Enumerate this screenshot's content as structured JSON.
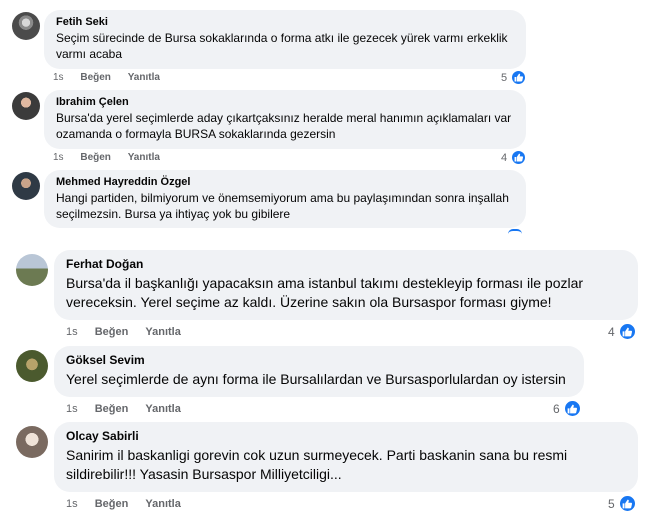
{
  "ui": {
    "like_label": "Beğen",
    "reply_label": "Yanıtla",
    "time_label": "1s",
    "colors": {
      "bubble_bg": "#f0f2f5",
      "like_blue": "#1877f2",
      "meta_gray": "#65676b"
    },
    "icons": {
      "reaction": "thumbs-up-icon"
    }
  },
  "comments": [
    {
      "author": "Fetih Seki",
      "text_lines": [
        "Seçim sürecinde de Bursa sokaklarında o forma atkı ile gezecek yürek varmı erkeklik",
        "varmı acaba"
      ],
      "reactions": "5"
    },
    {
      "author": "Ibrahim Çelen",
      "text_lines": [
        "Bursa'da yerel seçimlerde aday çıkartçaksınız heralde meral hanımın açıklamaları var",
        "ozamanda o formayla BURSA sokaklarında gezersin"
      ],
      "reactions": "4"
    },
    {
      "author": "Mehmed Hayreddin Özgel",
      "text_lines": [
        "Hangi partiden, bilmiyorum ve önemsemiyorum ama bu paylaşımından sonra inşallah",
        "seçilmezsin. Bursa ya ihtiyaç yok bu gibilere"
      ],
      "reactions": ""
    },
    {
      "author": "Ferhat Doğan",
      "text_lines": [
        "Bursa'da il başkanlığı yapacaksın ama istanbul takımı destekleyip forması ile pozlar",
        "vereceksin. Yerel seçime az kaldı. Üzerine sakın ola Bursaspor forması giyme!"
      ],
      "reactions": "4"
    },
    {
      "author": "Göksel Sevim",
      "text_lines": [
        "Yerel seçimlerde de aynı forma ile Bursalılardan ve Bursasporlulardan oy istersin"
      ],
      "reactions": "6"
    },
    {
      "author": "Olcay Sabirli",
      "text_lines": [
        "Sanirim il baskanligi gorevin cok uzun surmeyecek. Parti baskanin sana bu resmi",
        "sildirebilir!!! Yasasin Bursaspor Milliyetciligi..."
      ],
      "reactions": "5"
    }
  ]
}
